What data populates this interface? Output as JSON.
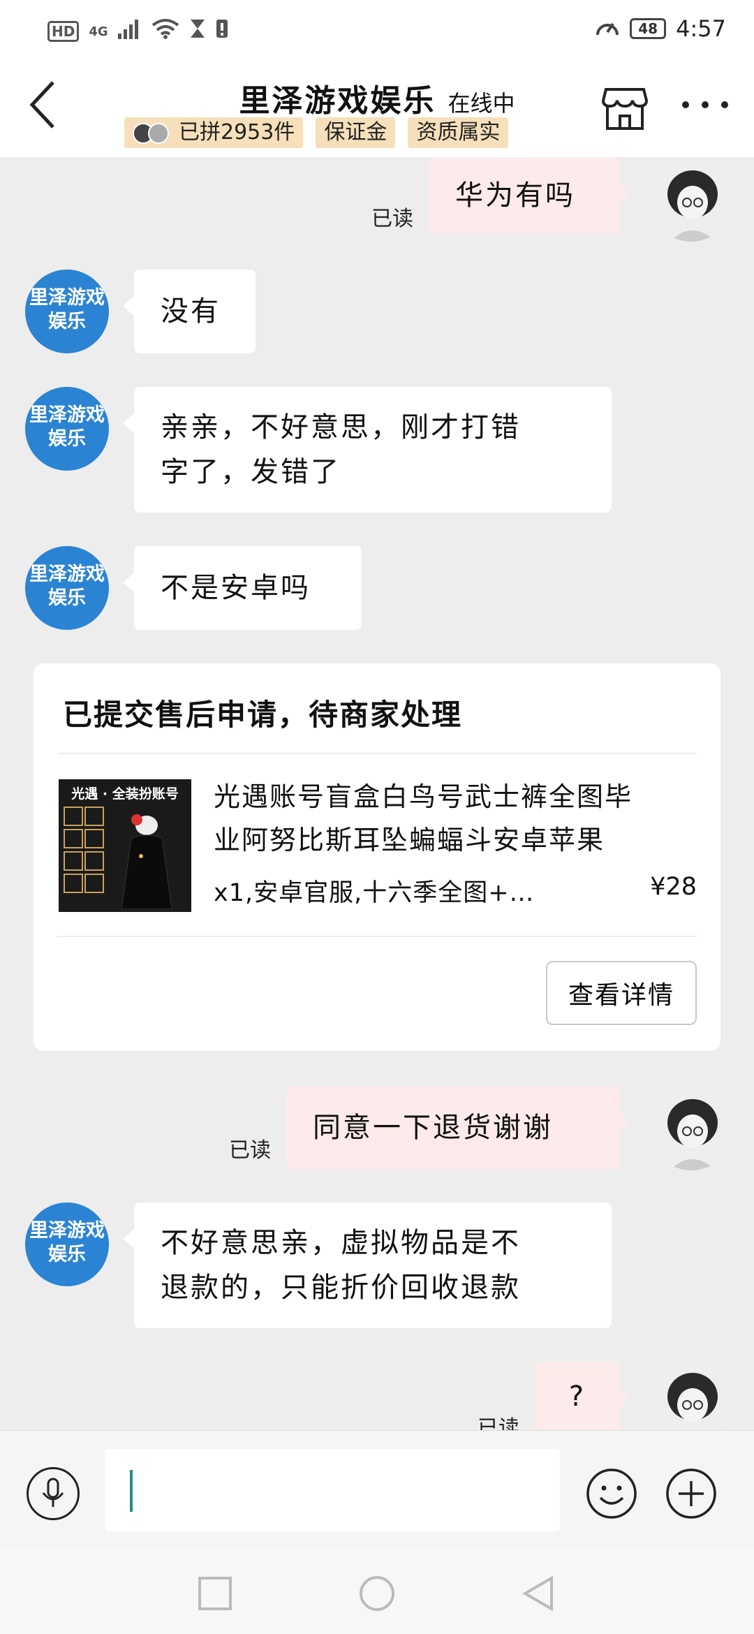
{
  "status_bar": {
    "hd": "HD",
    "network": "4G",
    "battery": "48",
    "time": "4:57"
  },
  "header": {
    "title": "里泽游戏娱乐",
    "status": "在线中",
    "badges": [
      "已拼2953件",
      "保证金",
      "资质属实"
    ]
  },
  "shop_avatar_text": "里泽游戏娱乐",
  "messages": [
    {
      "side": "right",
      "text": "华为有吗",
      "read": "已读"
    },
    {
      "side": "left",
      "text": "没有"
    },
    {
      "side": "left",
      "line1": "亲亲，不好意思，刚才打错",
      "line2": "字了，发错了"
    },
    {
      "side": "left",
      "text": "不是安卓吗"
    },
    {
      "side": "right",
      "text": "同意一下退货谢谢",
      "read": "已读"
    },
    {
      "side": "left",
      "line1": "不好意思亲，虚拟物品是不",
      "line2": "退款的，只能折价回收退款"
    },
    {
      "side": "right",
      "text": "?",
      "read": "已读"
    }
  ],
  "order_card": {
    "title": "已提交售后申请，待商家处理",
    "thumb_title": "光遇 · 全装扮账号",
    "product_line1": "光遇账号盲盒白鸟号武士裤全图毕",
    "product_line2": "业阿努比斯耳坠蝙蝠斗安卓苹果",
    "spec": "x1,安卓官服,十六季全图+…",
    "price": "¥28",
    "detail_button": "查看详情"
  },
  "input": {
    "placeholder": ""
  },
  "icons": {
    "back": "chevron-left-icon",
    "store": "store-icon",
    "more": "more-dots-icon",
    "voice": "microphone-icon",
    "emoji": "smiley-icon",
    "plus": "plus-circle-icon"
  },
  "colors": {
    "shop_avatar": "#2b83d3",
    "badge_bg": "#f6dfba",
    "sent_bubble": "#fdeaea",
    "chat_bg": "#ededed"
  }
}
